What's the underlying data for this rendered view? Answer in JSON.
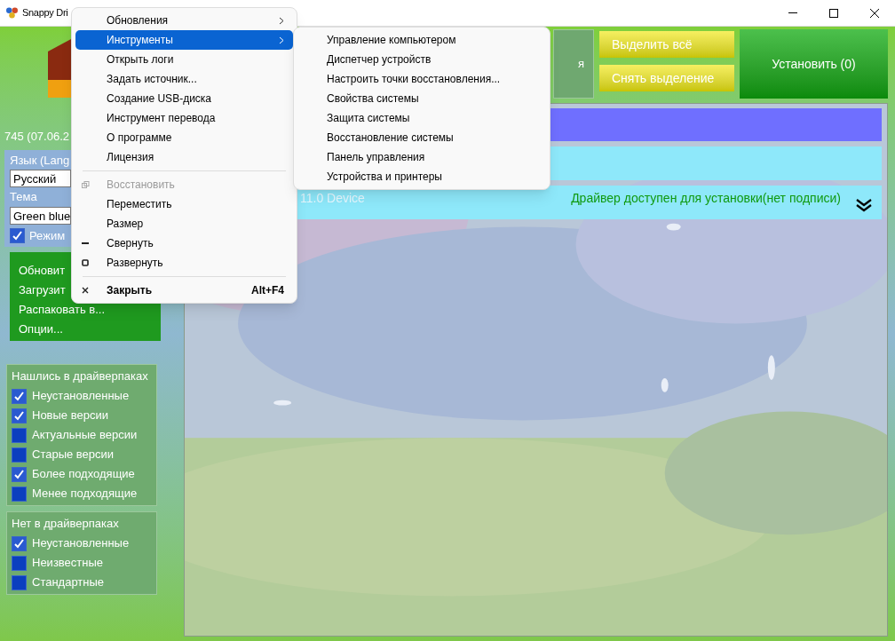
{
  "window": {
    "title": "Snappy Dri"
  },
  "sidebar": {
    "version": "745 (07.06.2",
    "language": {
      "label": "Язык (Lang",
      "value": "Русский"
    },
    "theme": {
      "label": "Тема",
      "value": "Green blue"
    },
    "expert_mode": {
      "label": "Режим",
      "checked": true
    },
    "actions": [
      "Обновит",
      "Загрузит",
      "Распаковать в...",
      "Опции..."
    ],
    "filter_groups": [
      {
        "title": "Нашлись в драйверпаках",
        "items": [
          {
            "label": "Неустановленные",
            "checked": true
          },
          {
            "label": "Новые версии",
            "checked": true
          },
          {
            "label": "Актуальные версии",
            "checked": false
          },
          {
            "label": "Старые версии",
            "checked": false
          },
          {
            "label": "Более подходящие",
            "checked": true
          },
          {
            "label": "Менее подходящие",
            "checked": false
          }
        ]
      },
      {
        "title": "Нет в драйверпаках",
        "items": [
          {
            "label": "Неустановленные",
            "checked": true
          },
          {
            "label": "Неизвестные",
            "checked": false
          },
          {
            "label": "Стандартные",
            "checked": false
          }
        ]
      }
    ]
  },
  "toolbar": {
    "info_text": "я",
    "select_all": "Выделить всё",
    "deselect": "Снять выделение",
    "install": "Установить (0)"
  },
  "devices": [
    {
      "kind": "header",
      "color": "#6f6fff"
    },
    {
      "kind": "group",
      "color": "#8ee8fa"
    },
    {
      "kind": "device",
      "color": "#8ee8fa",
      "name": "11.0 Device",
      "status": "Драйвер доступен для установки(нет подписи)"
    }
  ],
  "menu": {
    "items": [
      {
        "kind": "item",
        "label": "Обновления",
        "submenu": true,
        "selected": false
      },
      {
        "kind": "item",
        "label": "Инструменты",
        "submenu": true,
        "selected": true
      },
      {
        "kind": "item",
        "label": "Открыть логи",
        "selected": false
      },
      {
        "kind": "item",
        "label": "Задать источник...",
        "selected": false
      },
      {
        "kind": "item",
        "label": "Создание USB-диска",
        "selected": false
      },
      {
        "kind": "item",
        "label": "Инструмент перевода",
        "selected": false
      },
      {
        "kind": "item",
        "label": "О программе",
        "selected": false
      },
      {
        "kind": "item",
        "label": "Лицензия",
        "selected": false
      },
      {
        "kind": "separator"
      },
      {
        "kind": "restore",
        "label": "Восстановить",
        "disabled": true,
        "selected": false
      },
      {
        "kind": "item",
        "label": "Переместить",
        "selected": false
      },
      {
        "kind": "item",
        "label": "Размер",
        "selected": false
      },
      {
        "kind": "minimize",
        "label": "Свернуть",
        "selected": false
      },
      {
        "kind": "maximize",
        "label": "Развернуть",
        "selected": false
      },
      {
        "kind": "separator"
      },
      {
        "kind": "close",
        "label": "Закрыть",
        "bold": true,
        "shortcut": "Alt+F4",
        "selected": false
      }
    ]
  },
  "submenu": {
    "items": [
      "Управление компьютером",
      "Диспетчер устройств",
      "Настроить точки восстановления...",
      "Свойства системы",
      "Защита системы",
      "Восстановление системы",
      "Панель управления",
      "Устройства и принтеры"
    ]
  }
}
